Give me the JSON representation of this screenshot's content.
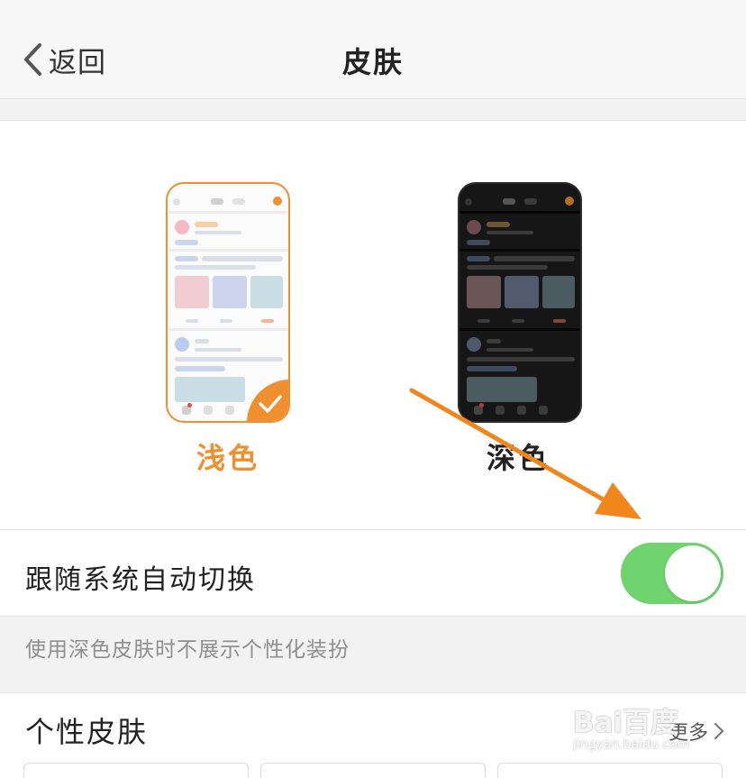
{
  "header": {
    "back_label": "返回",
    "title": "皮肤"
  },
  "skins": {
    "light": {
      "label": "浅色",
      "selected": true
    },
    "dark": {
      "label": "深色",
      "selected": false
    }
  },
  "follow_system": {
    "label": "跟随系统自动切换",
    "enabled": true
  },
  "note": "使用深色皮肤时不展示个性化装扮",
  "personal": {
    "title": "个性皮肤",
    "more_label": "更多"
  },
  "watermark": {
    "main": "Bai百度",
    "sub": "jingyan.baidu.com"
  },
  "colors": {
    "accent": "#ef8f2e",
    "toggle_on": "#6fd36e",
    "arrow": "#f0861c"
  }
}
